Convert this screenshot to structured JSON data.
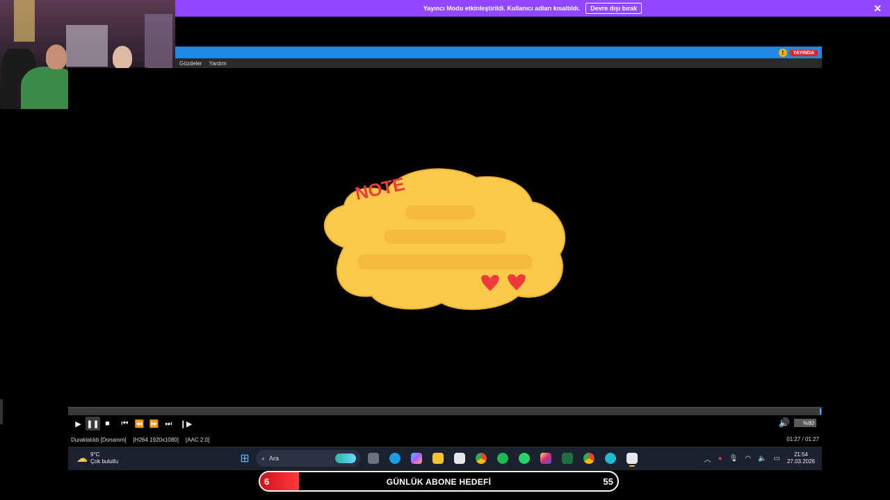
{
  "banner": {
    "message": "Yayıncı Modu etkinleştirildi. Kullanıcı adları kısaltıldı.",
    "button_label": "Devre dışı bırak",
    "close_icon": "close-icon",
    "color": "#9147ff"
  },
  "player": {
    "titlebar_color": "#1e88e5",
    "live_badge": "YAYINDA",
    "menu": [
      "Gözdeler",
      "Yardım"
    ],
    "video_note_text": "NOTE",
    "progress": 1.0,
    "volume_label": "%80",
    "status": {
      "state": "Duraklatıldı [Donanım]",
      "video_codec": "[H264 1920x1080]",
      "audio_codec": "[AAC 2.0]",
      "time": "01:27 / 01:27"
    },
    "controls": [
      "play-icon",
      "pause-icon",
      "stop-icon",
      "skip-previous-icon",
      "rewind-icon",
      "fast-forward-icon",
      "skip-next-icon",
      "frame-step-icon"
    ]
  },
  "taskbar": {
    "weather_temp": "9°C",
    "weather_desc": "Çok bulutlu",
    "search_placeholder": "Ara",
    "apps": [
      "task-view-icon",
      "edge-icon",
      "copilot-icon",
      "file-explorer-icon",
      "store-icon",
      "chrome-icon",
      "spotify-icon",
      "whatsapp-icon",
      "instagram-icon",
      "excel-icon",
      "chrome-profile-icon",
      "app-icon",
      "clapperboard-icon"
    ],
    "clock_time": "21:54",
    "clock_date": "27.03.2026"
  },
  "goal": {
    "title": "GÜNLÜK ABONE HEDEFİ",
    "current": "6",
    "target": "55",
    "fraction": 0.109
  }
}
